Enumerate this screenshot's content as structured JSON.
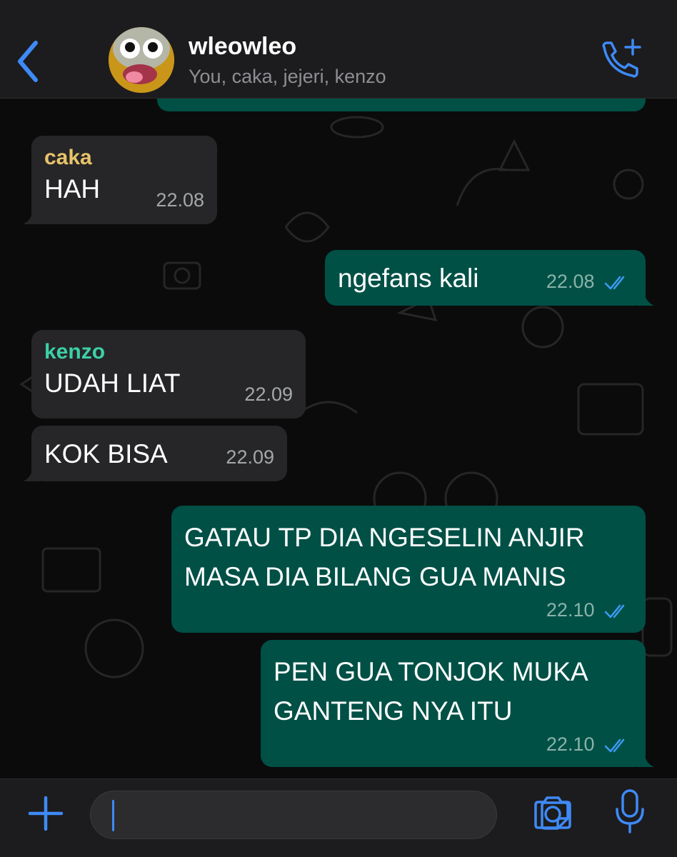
{
  "header": {
    "title": "wleowleo",
    "subtitle": "You, caka, jejeri, kenzo",
    "back_icon": "chevron-left-icon",
    "call_icon": "add-call-icon"
  },
  "colors": {
    "accent": "#3e8af7",
    "outgoing_bubble": "#005046",
    "incoming_bubble": "#262628",
    "sender_caka": "#e8c36a",
    "sender_kenzo": "#3cd0a6"
  },
  "messages": [
    {
      "direction": "in",
      "sender": "caka",
      "text": "HAH",
      "time": "22.08"
    },
    {
      "direction": "out",
      "text": "ngefans kali",
      "time": "22.08",
      "status": "read"
    },
    {
      "direction": "in",
      "sender": "kenzo",
      "text": "UDAH LIAT",
      "time": "22.09"
    },
    {
      "direction": "in",
      "text": "KOK BISA",
      "time": "22.09"
    },
    {
      "direction": "out",
      "lines": [
        "GATAU TP DIA NGESELIN ANJIR",
        "MASA DIA BILANG GUA MANIS"
      ],
      "time": "22.10",
      "status": "read"
    },
    {
      "direction": "out",
      "lines": [
        "PEN GUA TONJOK MUKA",
        "GANTENG NYA ITU"
      ],
      "time": "22.10",
      "status": "read"
    }
  ],
  "footer": {
    "plus_icon": "plus-icon",
    "sticker_icon": "sticker-icon",
    "camera_icon": "camera-icon",
    "mic_icon": "microphone-icon",
    "input_value": ""
  }
}
